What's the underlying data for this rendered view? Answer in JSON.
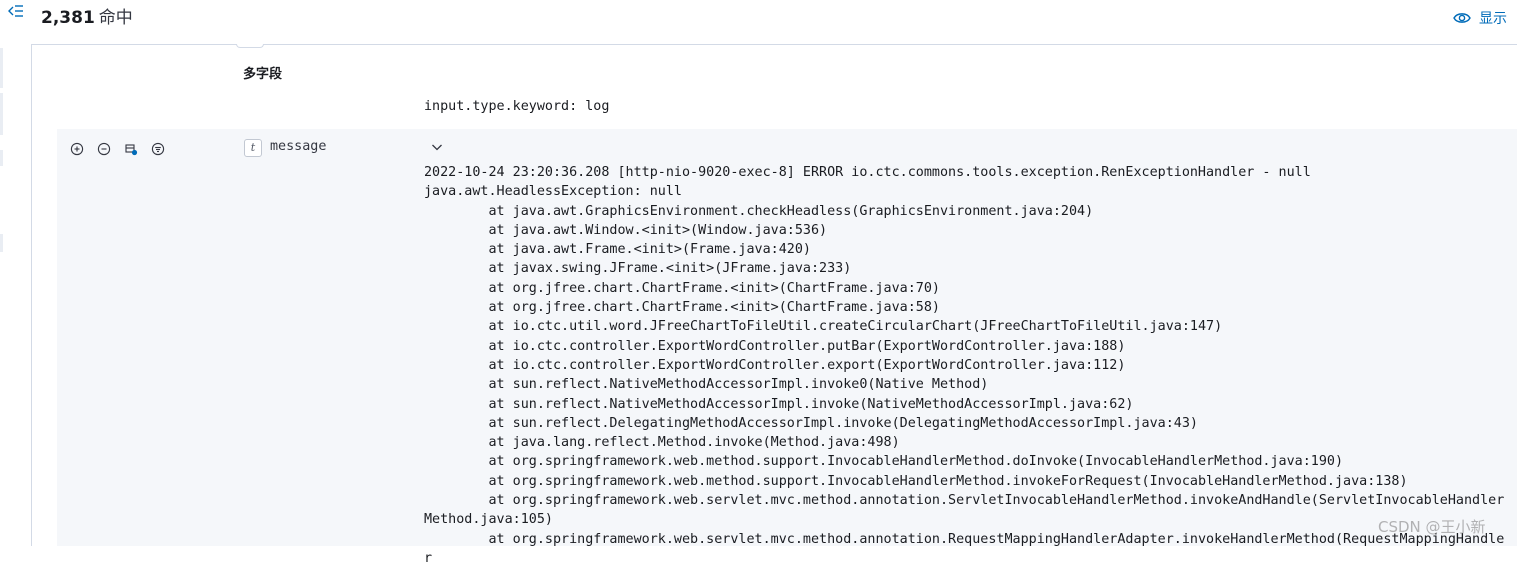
{
  "header": {
    "hit_count": "2,381",
    "hit_label": "命中",
    "show_button_label": "显示"
  },
  "document": {
    "multi_field_label": "多字段",
    "keyword_line": "input.type.keyword: log",
    "message_field": {
      "type_badge": "t",
      "name": "message",
      "value": "2022-10-24 23:20:36.208 [http-nio-9020-exec-8] ERROR io.ctc.commons.tools.exception.RenExceptionHandler - null\njava.awt.HeadlessException: null\n\tat java.awt.GraphicsEnvironment.checkHeadless(GraphicsEnvironment.java:204)\n\tat java.awt.Window.<init>(Window.java:536)\n\tat java.awt.Frame.<init>(Frame.java:420)\n\tat javax.swing.JFrame.<init>(JFrame.java:233)\n\tat org.jfree.chart.ChartFrame.<init>(ChartFrame.java:70)\n\tat org.jfree.chart.ChartFrame.<init>(ChartFrame.java:58)\n\tat io.ctc.util.word.JFreeChartToFileUtil.createCircularChart(JFreeChartToFileUtil.java:147)\n\tat io.ctc.controller.ExportWordController.putBar(ExportWordController.java:188)\n\tat io.ctc.controller.ExportWordController.export(ExportWordController.java:112)\n\tat sun.reflect.NativeMethodAccessorImpl.invoke0(Native Method)\n\tat sun.reflect.NativeMethodAccessorImpl.invoke(NativeMethodAccessorImpl.java:62)\n\tat sun.reflect.DelegatingMethodAccessorImpl.invoke(DelegatingMethodAccessorImpl.java:43)\n\tat java.lang.reflect.Method.invoke(Method.java:498)\n\tat org.springframework.web.method.support.InvocableHandlerMethod.doInvoke(InvocableHandlerMethod.java:190)\n\tat org.springframework.web.method.support.InvocableHandlerMethod.invokeForRequest(InvocableHandlerMethod.java:138)\n\tat org.springframework.web.servlet.mvc.method.annotation.ServletInvocableHandlerMethod.invokeAndHandle(ServletInvocableHandlerMethod.java:105)\n\tat org.springframework.web.servlet.mvc.method.annotation.RequestMappingHandlerAdapter.invokeHandlerMethod(RequestMappingHandler"
    }
  },
  "watermark": "CSDN @王小新",
  "colors": {
    "accent": "#006bb8",
    "row_background": "#f5f7fa",
    "border": "#d3dae6",
    "text": "#1a1c21"
  },
  "icons": {
    "sidebar_toggle": "menu-collapse-icon",
    "show": "eye-icon",
    "filter_for_value": "magnify-plus-icon",
    "filter_out_value": "magnify-minus-icon",
    "toggle_column": "table-column-icon",
    "filter_exists": "filter-icon",
    "collapse": "chevron-down-icon"
  }
}
